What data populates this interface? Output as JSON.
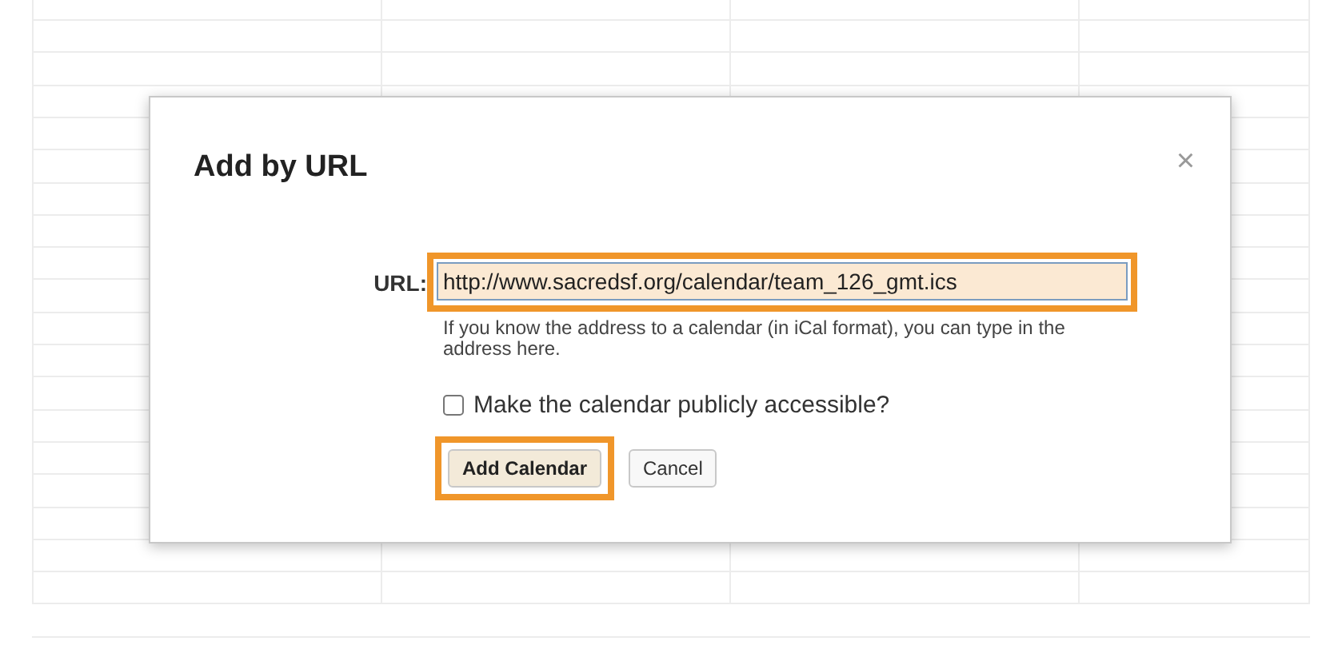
{
  "dialog": {
    "title": "Add by URL",
    "close": "×",
    "url_field": {
      "label": "URL:",
      "value": "http://www.sacredsf.org/calendar/team_126_gmt.ics",
      "highlighted": true
    },
    "help_text": "If you know the address to a calendar (in iCal format), you can type in the address here.",
    "public_checkbox": {
      "label": "Make the calendar publicly accessible?",
      "checked": false
    },
    "buttons": [
      {
        "label": "Add Calendar",
        "kind": "primary",
        "highlighted": true
      },
      {
        "label": "Cancel",
        "kind": "secondary",
        "highlighted": false
      }
    ]
  }
}
